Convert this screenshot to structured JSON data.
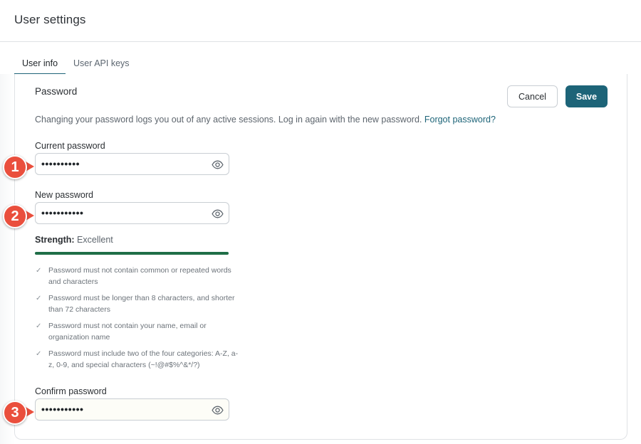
{
  "header": {
    "title": "User settings"
  },
  "tabs": [
    {
      "label": "User info",
      "active": true
    },
    {
      "label": "User API keys",
      "active": false
    }
  ],
  "password_section": {
    "title": "Password",
    "cancel_label": "Cancel",
    "save_label": "Save",
    "info": "Changing your password logs you out of any active sessions. Log in again with the new password.",
    "forgot_link": "Forgot password?"
  },
  "fields": {
    "current": {
      "label": "Current password",
      "value": "••••••••••"
    },
    "new": {
      "label": "New password",
      "value": "•••••••••••"
    },
    "confirm": {
      "label": "Confirm password",
      "value": "•••••••••••"
    }
  },
  "strength": {
    "label": "Strength:",
    "value": "Excellent",
    "level": 1.0,
    "color": "#1f6e47"
  },
  "rules": [
    "Password must not contain common or repeated words and characters",
    "Password must be longer than 8 characters, and shorter than 72 characters",
    "Password must not contain your name, email or organization name",
    "Password must include two of the four categories: A-Z, a-z, 0-9, and special characters (~!@#$%^&*/?)"
  ],
  "callouts": [
    "1",
    "2",
    "3"
  ],
  "icons": {
    "reveal": "eye-icon",
    "rule_check": "check-icon"
  },
  "colors": {
    "accent": "#1d6478",
    "callout": "#ea4f3d"
  }
}
